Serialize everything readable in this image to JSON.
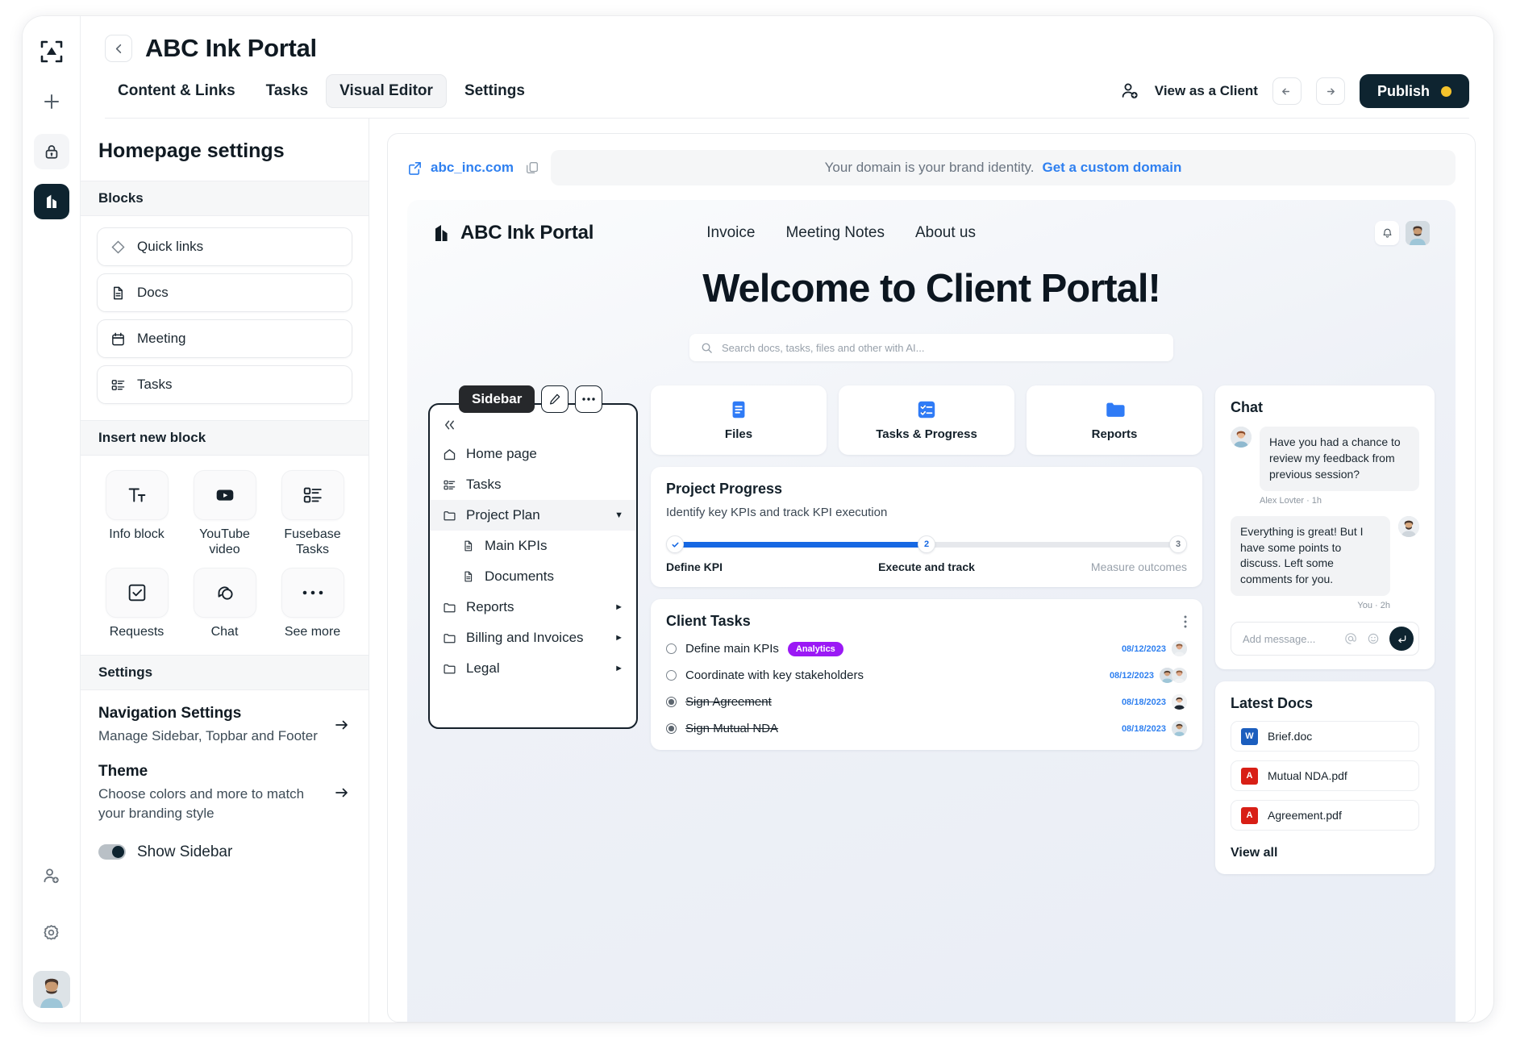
{
  "rail": {
    "logo_icon": "app-logo-icon",
    "items": [
      {
        "icon": "plus-icon",
        "name": "add-button"
      },
      {
        "icon": "lock-icon",
        "name": "lock-button"
      },
      {
        "icon": "portal-building-icon",
        "name": "portals-button",
        "active": true
      }
    ],
    "bottom": [
      {
        "icon": "invite-user-icon",
        "name": "invite-user-button"
      },
      {
        "icon": "gear-icon",
        "name": "settings-button"
      }
    ],
    "avatar_alt": "user-avatar"
  },
  "header": {
    "back_icon": "arrow-left-icon",
    "title": "ABC Ink Portal",
    "tabs": [
      {
        "label": "Content & Links",
        "selected": false
      },
      {
        "label": "Tasks",
        "selected": false
      },
      {
        "label": "Visual Editor",
        "selected": true
      },
      {
        "label": "Settings",
        "selected": false
      }
    ],
    "view_as_client": "View as a Client",
    "invite_icon": "invite-user-icon",
    "undo_icon": "arrow-left-icon",
    "redo_icon": "arrow-right-icon",
    "publish_label": "Publish",
    "publish_color": "#0e2430",
    "publish_dot_color": "#f5c32c"
  },
  "settings_panel": {
    "title": "Homepage settings",
    "blocks_heading": "Blocks",
    "blocks": [
      {
        "label": "Quick links",
        "icon": "diamond-icon"
      },
      {
        "label": "Docs",
        "icon": "document-icon"
      },
      {
        "label": "Meeting",
        "icon": "calendar-icon"
      },
      {
        "label": "Tasks",
        "icon": "task-list-icon"
      }
    ],
    "insert_heading": "Insert new block",
    "insert_blocks": [
      {
        "label": "Info block",
        "icon": "text-format-icon"
      },
      {
        "label": "YouTube video",
        "icon": "youtube-play-icon"
      },
      {
        "label": "Fusebase Tasks",
        "icon": "task-list-icon"
      },
      {
        "label": "Requests",
        "icon": "checkbox-icon"
      },
      {
        "label": "Chat",
        "icon": "chat-bubbles-icon"
      },
      {
        "label": "See more",
        "icon": "ellipsis-icon"
      }
    ],
    "settings_heading": "Settings",
    "navigation": {
      "name": "Navigation Settings",
      "desc": "Manage Sidebar, Topbar and Footer",
      "arrow_icon": "arrow-right-icon"
    },
    "theme": {
      "name": "Theme",
      "desc": "Choose colors and more to match your branding style",
      "arrow_icon": "arrow-right-icon"
    },
    "show_sidebar_label": "Show Sidebar",
    "show_sidebar_on": true
  },
  "domain_bar": {
    "external_icon": "external-link-icon",
    "domain": "abc_inc.com",
    "copy_icon": "copy-icon",
    "banner_text": "Your domain is your brand identity.",
    "banner_cta": "Get a custom domain",
    "link_color": "#2f80f0"
  },
  "portal": {
    "brand_name": "ABC Ink Portal",
    "brand_icon": "portal-building-icon",
    "links": [
      "Invoice",
      "Meeting Notes",
      "About us"
    ],
    "bell_icon": "bell-icon",
    "avatar_alt": "portal-user-avatar",
    "hero_title": "Welcome to Client Portal!",
    "search_placeholder": "Search docs, tasks, files and other with AI...",
    "search_icon": "search-icon",
    "sidebar_widget": {
      "tooltip": "Sidebar",
      "edit_icon": "pencil-icon",
      "more_icon": "ellipsis-icon",
      "collapse_icon": "chevrons-left-icon",
      "items": [
        {
          "label": "Home page",
          "icon": "home-icon",
          "child": false,
          "caret": "",
          "active": false
        },
        {
          "label": "Tasks",
          "icon": "task-list-icon",
          "child": false,
          "caret": "",
          "active": false
        },
        {
          "label": "Project Plan",
          "icon": "folder-icon",
          "child": false,
          "caret": "down",
          "active": true
        },
        {
          "label": "Main KPIs",
          "icon": "document-icon",
          "child": true,
          "caret": "",
          "active": false
        },
        {
          "label": "Documents",
          "icon": "document-icon",
          "child": true,
          "caret": "",
          "active": false
        },
        {
          "label": "Reports",
          "icon": "folder-icon",
          "child": false,
          "caret": "right",
          "active": false
        },
        {
          "label": "Billing and Invoices",
          "icon": "folder-icon",
          "child": false,
          "caret": "right",
          "active": false
        },
        {
          "label": "Legal",
          "icon": "folder-icon",
          "child": false,
          "caret": "right",
          "active": false
        }
      ]
    },
    "quick_cards": [
      {
        "label": "Files",
        "icon": "file-lines-icon",
        "color": "#2f7bf6"
      },
      {
        "label": "Tasks & Progress",
        "icon": "checklist-icon",
        "color": "#2f7bf6"
      },
      {
        "label": "Reports",
        "icon": "folder-filled-icon",
        "color": "#2f7bf6"
      }
    ],
    "project_progress": {
      "title": "Project Progress",
      "subtitle": "Identify key KPIs and track KPI execution",
      "steps": [
        {
          "marker": "check",
          "label": "Define KPI",
          "state": "complete"
        },
        {
          "marker": "2",
          "label": "Execute and track",
          "state": "current"
        },
        {
          "marker": "3",
          "label": "Measure outcomes",
          "state": "upcoming"
        }
      ],
      "fill_percent": 48,
      "fill_color": "#1668e3"
    },
    "client_tasks": {
      "title": "Client Tasks",
      "menu_icon": "kebab-menu-icon",
      "rows": [
        {
          "name": "Define main KPIs",
          "chip": "Analytics",
          "chip_color": "#9b19f5",
          "date": "08/12/2023",
          "done": false,
          "avatars": 1
        },
        {
          "name": "Coordinate with key stakeholders",
          "chip": "",
          "date": "08/12/2023",
          "done": false,
          "avatars": 2
        },
        {
          "name": "Sign Agreement",
          "chip": "",
          "date": "08/18/2023",
          "done": true,
          "avatars": 1
        },
        {
          "name": "Sign Mutual NDA",
          "chip": "",
          "date": "08/18/2023",
          "done": true,
          "avatars": 1
        }
      ]
    },
    "chat": {
      "title": "Chat",
      "messages": [
        {
          "text": "Have you had a chance to review my feedback from previous session?",
          "meta": "Alex Lovter · 1h",
          "from": "them"
        },
        {
          "text": "Everything is great! But I have some points to discuss. Left some comments for you.",
          "meta": "You · 2h",
          "from": "me"
        }
      ],
      "input_placeholder": "Add message...",
      "mention_icon": "at-icon",
      "emoji_icon": "emoji-icon",
      "send_icon": "send-enter-icon"
    },
    "latest_docs": {
      "title": "Latest Docs",
      "docs": [
        {
          "name": "Brief.doc",
          "type": "word",
          "badge": "W"
        },
        {
          "name": "Mutual NDA.pdf",
          "type": "pdf",
          "badge": "A"
        },
        {
          "name": "Agreement.pdf",
          "type": "pdf",
          "badge": "A"
        }
      ],
      "view_all": "View all"
    }
  }
}
